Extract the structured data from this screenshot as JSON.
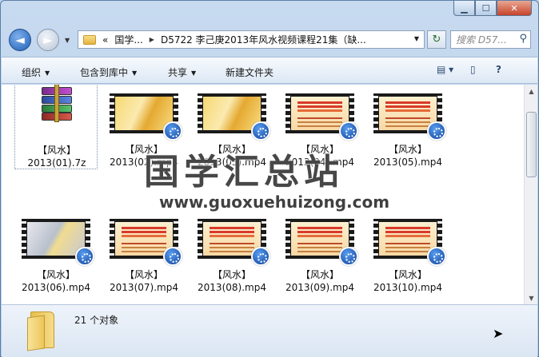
{
  "window": {
    "controls": {
      "minimize": "▁",
      "maximize": "☐",
      "close": "✕"
    }
  },
  "nav": {
    "back_glyph": "◄",
    "forward_glyph": "►",
    "breadcrumb": [
      "«",
      "国学...",
      "D5722 李己庚2013年风水视频课程21集（缺..."
    ],
    "refresh_glyph": "↻",
    "search_placeholder": "搜索 D57..."
  },
  "toolbar": {
    "organize": "组织",
    "include_library": "包含到库中",
    "share": "共享",
    "new_folder": "新建文件夹"
  },
  "files": [
    {
      "line1": "【风水】",
      "line2": "2013(01).7z",
      "kind": "archive"
    },
    {
      "line1": "【风水】",
      "line2": "2013(02).mp4",
      "kind": "gold"
    },
    {
      "line1": "【风水】",
      "line2": "2013(03).mp4",
      "kind": "gold"
    },
    {
      "line1": "【风水】",
      "line2": "2013(04).mp4",
      "kind": "red"
    },
    {
      "line1": "【风水】",
      "line2": "2013(05).mp4",
      "kind": "red"
    },
    {
      "line1": "【风水】",
      "line2": "2013(06).mp4",
      "kind": "photo"
    },
    {
      "line1": "【风水】",
      "line2": "2013(07).mp4",
      "kind": "red"
    },
    {
      "line1": "【风水】",
      "line2": "2013(08).mp4",
      "kind": "red"
    },
    {
      "line1": "【风水】",
      "line2": "2013(09).mp4",
      "kind": "red"
    },
    {
      "line1": "【风水】",
      "line2": "2013(10).mp4",
      "kind": "red"
    }
  ],
  "watermark": {
    "title": "国学汇总站",
    "url": "www.guoxuehuizong.com"
  },
  "details": {
    "count": "21 个对象"
  },
  "colors": {
    "selection_border": "#7b8fa8",
    "toolbar_bg": "#dde8f5",
    "accent_blue": "#1f5fb6"
  }
}
